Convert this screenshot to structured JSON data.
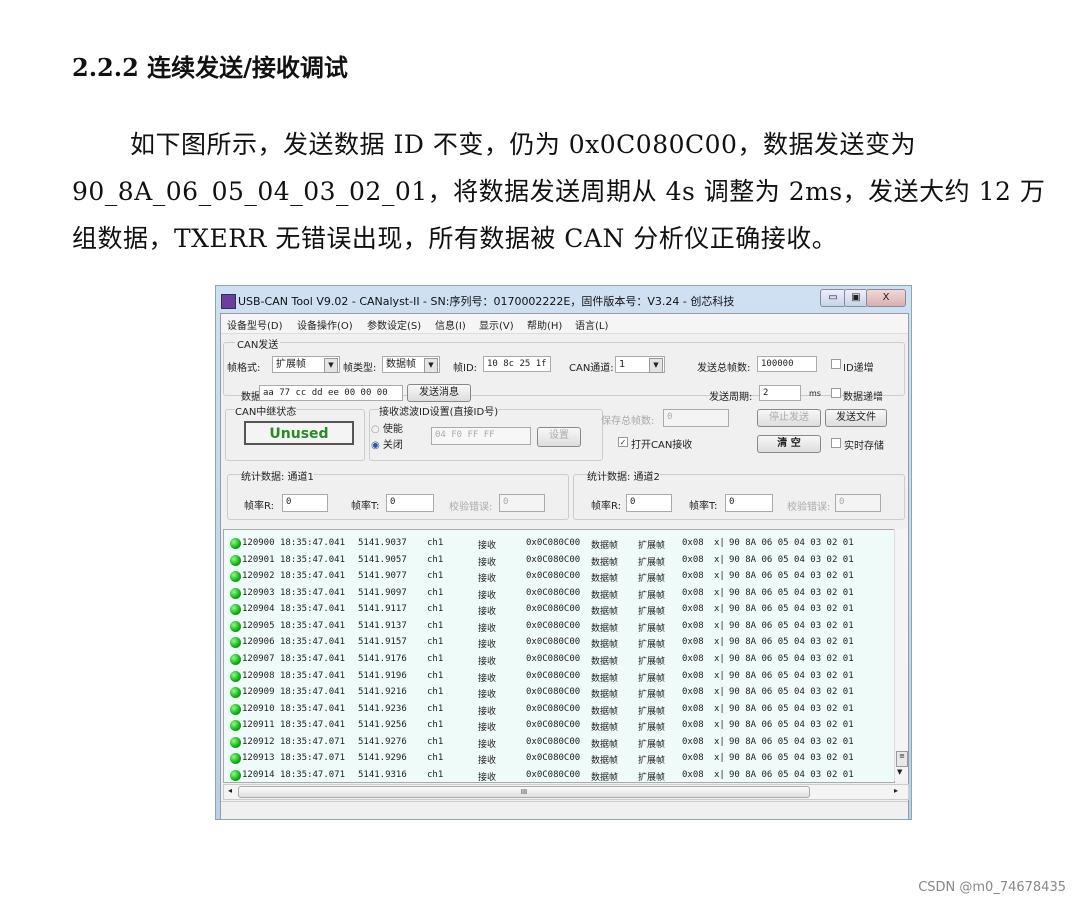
{
  "doc": {
    "heading": "2.2.2  连续发送/接收调试",
    "para_lines": [
      "如下图所示，发送数据 ID 不变，仍为 0x0C080C00，数据发送变为",
      "90_8A_06_05_04_03_02_01，将数据发送周期从 4s 调整为 2ms，发送大约 12 万",
      "组数据，TXERR 无错误出现，所有数据被 CAN 分析仪正确接收。"
    ],
    "watermark": "CSDN @m0_74678435"
  },
  "window": {
    "title": "USB-CAN Tool V9.02 - CANalyst-II - SN:序列号：0170002222E，固件版本号：V3.24 - 创芯科技",
    "controls": {
      "min": "▭",
      "max": "▣",
      "close": "X"
    },
    "menu": [
      "设备型号(D)",
      "设备操作(O)",
      "参数设定(S)",
      "信息(I)",
      "显示(V)",
      "帮助(H)",
      "语言(L)"
    ],
    "send": {
      "group": "CAN发送",
      "frame_format_label": "帧格式:",
      "frame_format": "扩展帧",
      "frame_type_label": "帧类型:",
      "frame_type": "数据帧",
      "frame_id_label": "帧ID:",
      "frame_id": "10 8c 25 1f",
      "channel_label": "CAN通道:",
      "channel": "1",
      "total_label": "发送总帧数:",
      "total": "100000",
      "id_inc": "ID递增",
      "id_inc_checked": false,
      "data_label": "数据:",
      "data": "aa 77 cc dd ee 00 00 00",
      "send_btn": "发送消息",
      "period_label": "发送周期:",
      "period": "2",
      "period_unit": "ms",
      "data_inc": "数据递增",
      "data_inc_checked": false
    },
    "relay": {
      "group": "CAN中继状态",
      "status": "Unused"
    },
    "filter": {
      "group": "接收滤波ID设置(直接ID号)",
      "enable": "使能",
      "disable": "关闭",
      "selected": "关闭",
      "value": "04 F0 FF FF",
      "set_btn": "设置"
    },
    "save_total_label": "保存总帧数:",
    "save_total": "0",
    "stop_btn": "停止发送",
    "send_file_btn": "发送文件",
    "open_recv": "打开CAN接收",
    "open_recv_checked": true,
    "clear_btn": "清 空",
    "realtime_save": "实时存储",
    "realtime_save_checked": false,
    "stats1": {
      "group": "统计数据: 通道1",
      "rate_r_label": "帧率R:",
      "rate_r": "0",
      "rate_t_label": "帧率T:",
      "rate_t": "0",
      "err_label": "校验错误:",
      "err": "0"
    },
    "stats2": {
      "group": "统计数据: 通道2",
      "rate_r_label": "帧率R:",
      "rate_r": "0",
      "rate_t_label": "帧率T:",
      "rate_t": "0",
      "err_label": "校验错误:",
      "err": "0"
    },
    "hscroll_grip": "III",
    "rows": [
      [
        "120900",
        "18:35:47.041",
        "5141.9037"
      ],
      [
        "120901",
        "18:35:47.041",
        "5141.9057"
      ],
      [
        "120902",
        "18:35:47.041",
        "5141.9077"
      ],
      [
        "120903",
        "18:35:47.041",
        "5141.9097"
      ],
      [
        "120904",
        "18:35:47.041",
        "5141.9117"
      ],
      [
        "120905",
        "18:35:47.041",
        "5141.9137"
      ],
      [
        "120906",
        "18:35:47.041",
        "5141.9157"
      ],
      [
        "120907",
        "18:35:47.041",
        "5141.9176"
      ],
      [
        "120908",
        "18:35:47.041",
        "5141.9196"
      ],
      [
        "120909",
        "18:35:47.041",
        "5141.9216"
      ],
      [
        "120910",
        "18:35:47.041",
        "5141.9236"
      ],
      [
        "120911",
        "18:35:47.041",
        "5141.9256"
      ],
      [
        "120912",
        "18:35:47.071",
        "5141.9276"
      ],
      [
        "120913",
        "18:35:47.071",
        "5141.9296"
      ],
      [
        "120914",
        "18:35:47.071",
        "5141.9316"
      ]
    ],
    "row_common": {
      "ch": "ch1",
      "dir": "接收",
      "id": "0x0C080C00",
      "type": "数据帧",
      "format": "扩展帧",
      "dlc": "0x08",
      "sep": "x|",
      "data": "90 8A 06 05 04 03 02 01"
    }
  }
}
